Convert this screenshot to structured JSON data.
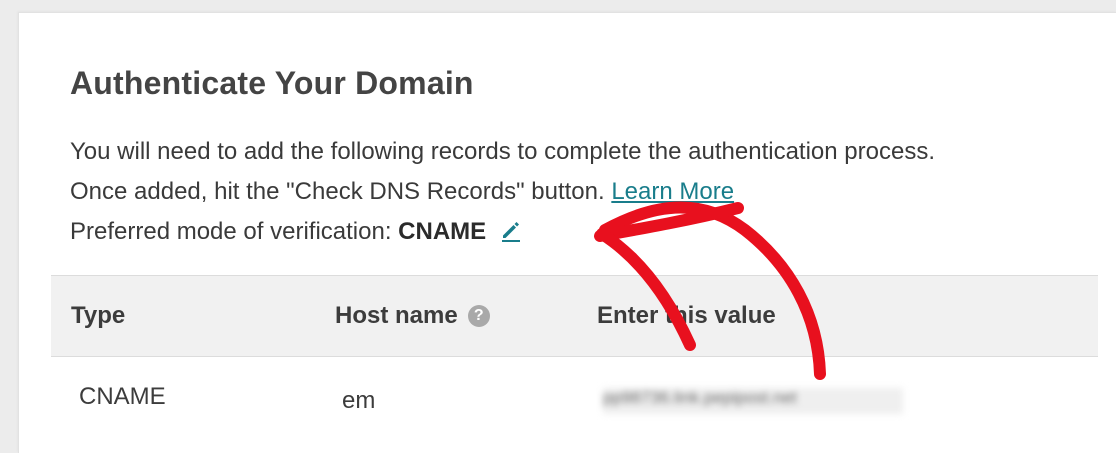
{
  "page": {
    "title": "Authenticate Your Domain",
    "description_line1": "You will need to add the following records to complete the authentication process.",
    "description_line2_prefix": "Once added, hit the \"Check DNS Records\" button.",
    "learn_more_label": "Learn More",
    "mode_label": "Preferred mode of verification:",
    "mode_value": "CNAME"
  },
  "table": {
    "headers": {
      "type": "Type",
      "host": "Host name",
      "value": "Enter this value"
    },
    "rows": [
      {
        "type": "CNAME",
        "host": "em",
        "value": "pp98736.link.pepipost.net"
      }
    ]
  },
  "icons": {
    "edit": "pencil-edit-icon",
    "help": "question-help-icon"
  },
  "colors": {
    "link": "#197d8b",
    "annotation_arrow": "#e8101e",
    "header_bg": "#f1f1f1"
  }
}
